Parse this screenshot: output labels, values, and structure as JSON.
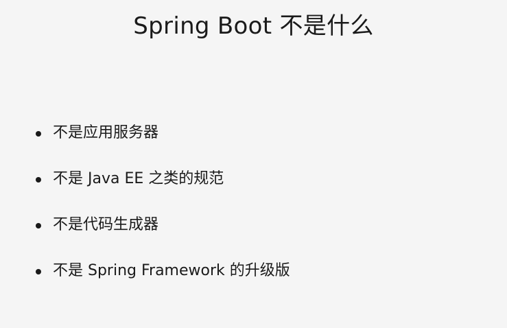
{
  "slide": {
    "title": "Spring Boot 不是什么",
    "bullets": [
      "不是应用服务器",
      "不是 Java EE 之类的规范",
      "不是代码生成器",
      "不是 Spring Framework 的升级版"
    ]
  },
  "colors": {
    "background": "#f5f5f5",
    "text": "#1a1a1a"
  }
}
